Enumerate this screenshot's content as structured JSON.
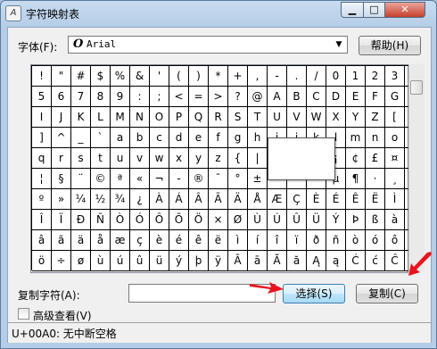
{
  "window": {
    "title": "字符映射表",
    "icon": "charmap-app-icon"
  },
  "titlebar_buttons": {
    "minimize": "▁",
    "maximize": "□",
    "close": "✕"
  },
  "font": {
    "label": "字体(F):",
    "selected": "Arial",
    "help_label": "帮助(H)"
  },
  "charset": [
    [
      "!",
      "\"",
      "#",
      "$",
      "%",
      "&",
      "'",
      "(",
      ")",
      "*",
      "+",
      ",",
      "-",
      ".",
      "/",
      "0",
      "1",
      "2",
      "3",
      "4"
    ],
    [
      "5",
      "6",
      "7",
      "8",
      "9",
      ":",
      ";",
      "<",
      "=",
      ">",
      "?",
      "@",
      "A",
      "B",
      "C",
      "D",
      "E",
      "F",
      "G",
      "H"
    ],
    [
      "I",
      "J",
      "K",
      "L",
      "M",
      "N",
      "O",
      "P",
      "Q",
      "R",
      "S",
      "T",
      "U",
      "V",
      "W",
      "X",
      "Y",
      "Z",
      "[",
      "\\"
    ],
    [
      "]",
      "^",
      "_",
      "`",
      "a",
      "b",
      "c",
      "d",
      "e",
      "f",
      "g",
      "h",
      "i",
      "j",
      "k",
      "l",
      "m",
      "n",
      "o",
      "p"
    ],
    [
      "q",
      "r",
      "s",
      "t",
      "u",
      "v",
      "w",
      "x",
      "y",
      "z",
      "{",
      "|",
      "}",
      "~",
      "",
      "¡",
      "¢",
      "£",
      "¤",
      "¥"
    ],
    [
      "¦",
      "§",
      "¨",
      "©",
      "ª",
      "«",
      "¬",
      "-",
      "®",
      "¯",
      "°",
      "±",
      "²",
      "³",
      "´",
      "µ",
      "¶",
      "·",
      "¸",
      "¹"
    ],
    [
      "º",
      "»",
      "¼",
      "½",
      "¾",
      "¿",
      "À",
      "Á",
      "Â",
      "Ã",
      "Ä",
      "Å",
      "Æ",
      "Ç",
      "È",
      "É",
      "Ê",
      "Ë",
      "Ì",
      "Í"
    ],
    [
      "Î",
      "Ï",
      "Ð",
      "Ñ",
      "Ò",
      "Ó",
      "Ô",
      "Õ",
      "Ö",
      "×",
      "Ø",
      "Ù",
      "Ú",
      "Û",
      "Ü",
      "Ý",
      "Þ",
      "ß",
      "à",
      "á"
    ],
    [
      "â",
      "ã",
      "ä",
      "å",
      "æ",
      "ç",
      "è",
      "é",
      "ê",
      "ë",
      "ì",
      "í",
      "î",
      "ï",
      "ð",
      "ñ",
      "ò",
      "ó",
      "ô",
      "õ"
    ],
    [
      "ö",
      "÷",
      "ø",
      "ù",
      "ú",
      "û",
      "ü",
      "ý",
      "þ",
      "ÿ",
      "Ā",
      "ā",
      "Ă",
      "ă",
      "Ą",
      "ą",
      "Ć",
      "ć",
      "Ĉ",
      "ĉ"
    ]
  ],
  "copy": {
    "label": "复制字符(A):",
    "value": "",
    "select_label": "选择(S)",
    "copy_label": "复制(C)"
  },
  "advanced": {
    "label": "高级查看(V)",
    "checked": false
  },
  "status": {
    "text": "U+00A0: 无中断空格"
  },
  "annotation_color": "#e8141e"
}
